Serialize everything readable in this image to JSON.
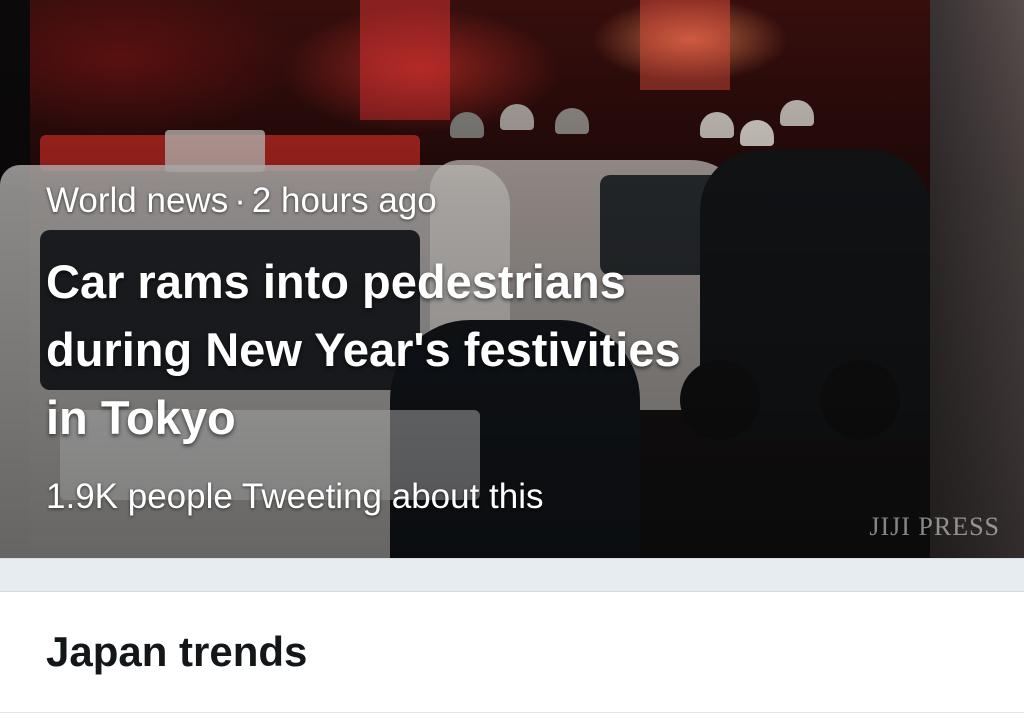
{
  "hero": {
    "category": "World news",
    "separator": "·",
    "time": "2 hours ago",
    "headline_lines": [
      "Car rams into pedestrians",
      "during New Year's festivities",
      "in Tokyo"
    ],
    "tweet_count": "1.9K people Tweeting about this",
    "watermark": "JIJI PRESS"
  },
  "trends": {
    "title": "Japan trends"
  }
}
